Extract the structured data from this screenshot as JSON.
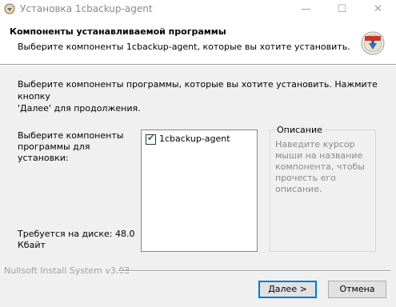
{
  "window": {
    "title": "Установка 1cbackup-agent",
    "minimize_glyph": "—",
    "maximize_glyph": "☐",
    "close_glyph": "✕"
  },
  "header": {
    "title": "Компоненты устанавливаемой программы",
    "subtitle": "Выберите компоненты 1cbackup-agent, которые вы хотите установить."
  },
  "main": {
    "intro": "Выберите компоненты программы, которые вы хотите установить. Нажмите кнопку\n'Далее' для продолжения.",
    "select_label": "Выберите компоненты\nпрограммы для установки:",
    "components": [
      {
        "label": "1cbackup-agent",
        "checked": true
      }
    ],
    "description": {
      "title": "Описание",
      "placeholder": "Наведите курсор мыши на название компонента, чтобы прочесть его описание."
    },
    "disk_required": "Требуется на диске: 48.0 Кбайт"
  },
  "footer": {
    "branding": "Nullsoft Install System v3.03",
    "next_label": "Далее >",
    "cancel_label": "Отмена"
  },
  "icons": {
    "app": "installer-icon",
    "header_logo": "installer-logo-icon",
    "checkmark": "✔"
  },
  "colors": {
    "accent": "#0078d7",
    "check": "#1a7a2a",
    "disabled_text": "#8a8a8a"
  }
}
